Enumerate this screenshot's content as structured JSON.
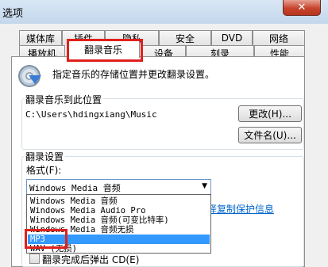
{
  "window": {
    "title": "选项",
    "close_glyph": "✕"
  },
  "tabs": {
    "row1": [
      "媒体库",
      "插件",
      "隐私",
      "安全",
      "DVD",
      "网络"
    ],
    "row2": [
      "播放机",
      "翻录音乐",
      "设备",
      "刻录",
      "性能"
    ],
    "active": "翻录音乐"
  },
  "intro": {
    "icon": "cd-rip-icon",
    "text": "指定音乐的存储位置并更改翻录设置。"
  },
  "rip_location": {
    "legend": "翻录音乐到此位置",
    "path": "C:\\Users\\hdingxiang\\Music",
    "change_label": "更改(H)...",
    "filename_label": "文件名(U)..."
  },
  "rip_settings": {
    "legend": "翻录设置",
    "format_label": "格式(F):",
    "format_value": "Windows Media 音频",
    "format_options": [
      "Windows Media 音频",
      "Windows Media Audio Pro",
      "Windows Media 音频(可变比特率)",
      "Windows Media 音频无损",
      "MP3",
      "WAV (无损)"
    ],
    "selected_option": "MP3",
    "copy_protection_link": "译复制保护信息",
    "eject_label": "翻录完成后弹出 CD(E)"
  },
  "colors": {
    "highlight": "#3399ff",
    "annotation": "#e0201c",
    "link": "#0066cc"
  }
}
